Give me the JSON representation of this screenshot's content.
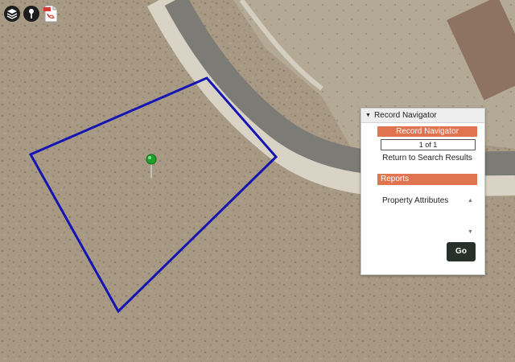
{
  "colors": {
    "parcel_outline": "#1515b4",
    "pin": "#1fa02a",
    "accent": "#e07451",
    "go_button": "#27302a",
    "road": "#7d7b76"
  },
  "toolbar": {
    "buttons": [
      {
        "name": "layers",
        "icon": "layers-icon"
      },
      {
        "name": "location-pin",
        "icon": "map-pin-icon"
      },
      {
        "name": "pdf",
        "icon": "pdf-icon"
      }
    ]
  },
  "panel": {
    "header": "Record Navigator",
    "navigator_label": "Record Navigator",
    "record_count": "1 of 1",
    "return_link": "Return to Search Results",
    "reports_label": "Reports",
    "report_items": [
      "Property Attributes"
    ],
    "go_label": "Go"
  }
}
